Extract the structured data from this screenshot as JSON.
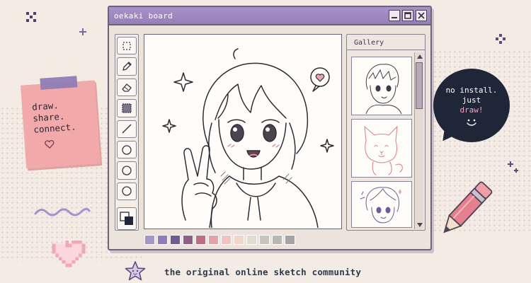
{
  "window": {
    "title": "oekaki board",
    "controls": {
      "minimize": "minimize-icon",
      "maximize": "maximize-icon",
      "close": "close-icon"
    }
  },
  "toolbar": {
    "tools": [
      "select-icon",
      "pencil-icon",
      "eraser-icon",
      "fill-icon",
      "line-icon",
      "circle-icon",
      "circle-icon",
      "circle-icon",
      "color-swap-icon"
    ]
  },
  "palette": {
    "colors": [
      "#a596c8",
      "#8f7bb7",
      "#6f5b8c",
      "#935e85",
      "#c16d80",
      "#e3a2a4",
      "#efc3c0",
      "#f3d5c6",
      "#e2dccf",
      "#c9c3bb",
      "#bcb6b2",
      "#a7a2a6"
    ]
  },
  "gallery": {
    "title": "Gallery"
  },
  "sticky_note": {
    "lines": [
      "draw.",
      "share.",
      "connect."
    ],
    "heart": "heart-icon"
  },
  "speech_bubble": {
    "line1": "no install.",
    "line2": "just",
    "line3": "draw!",
    "face": "smiley-icon"
  },
  "tagline": "the original online sketch community",
  "colors": {
    "background": "#f4ece4",
    "titlebar": "#9f8ac1",
    "bubble": "#1f2637",
    "sticky": "#f1a9a9"
  }
}
